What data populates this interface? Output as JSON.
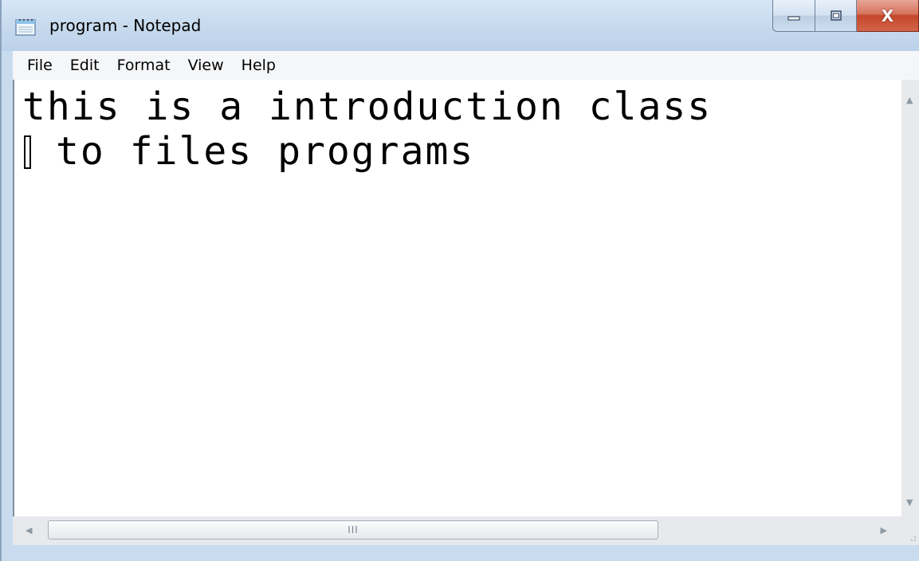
{
  "window": {
    "title": "program - Notepad",
    "controls": {
      "minimize_icon": "minimize-icon",
      "maximize_icon": "maximize-icon",
      "close_label": "X"
    }
  },
  "menu": {
    "items": [
      {
        "label": "File"
      },
      {
        "label": "Edit"
      },
      {
        "label": "Format"
      },
      {
        "label": "View"
      },
      {
        "label": "Help"
      }
    ]
  },
  "editor": {
    "lines": [
      "this is a introduction class",
      "to files programs"
    ],
    "caret_glyph": "▯"
  },
  "scrollbars": {
    "horizontal_grip": "III"
  },
  "colors": {
    "close_button": "#c4472a",
    "titlebar": "#c6d9ed",
    "text": "#000000"
  }
}
